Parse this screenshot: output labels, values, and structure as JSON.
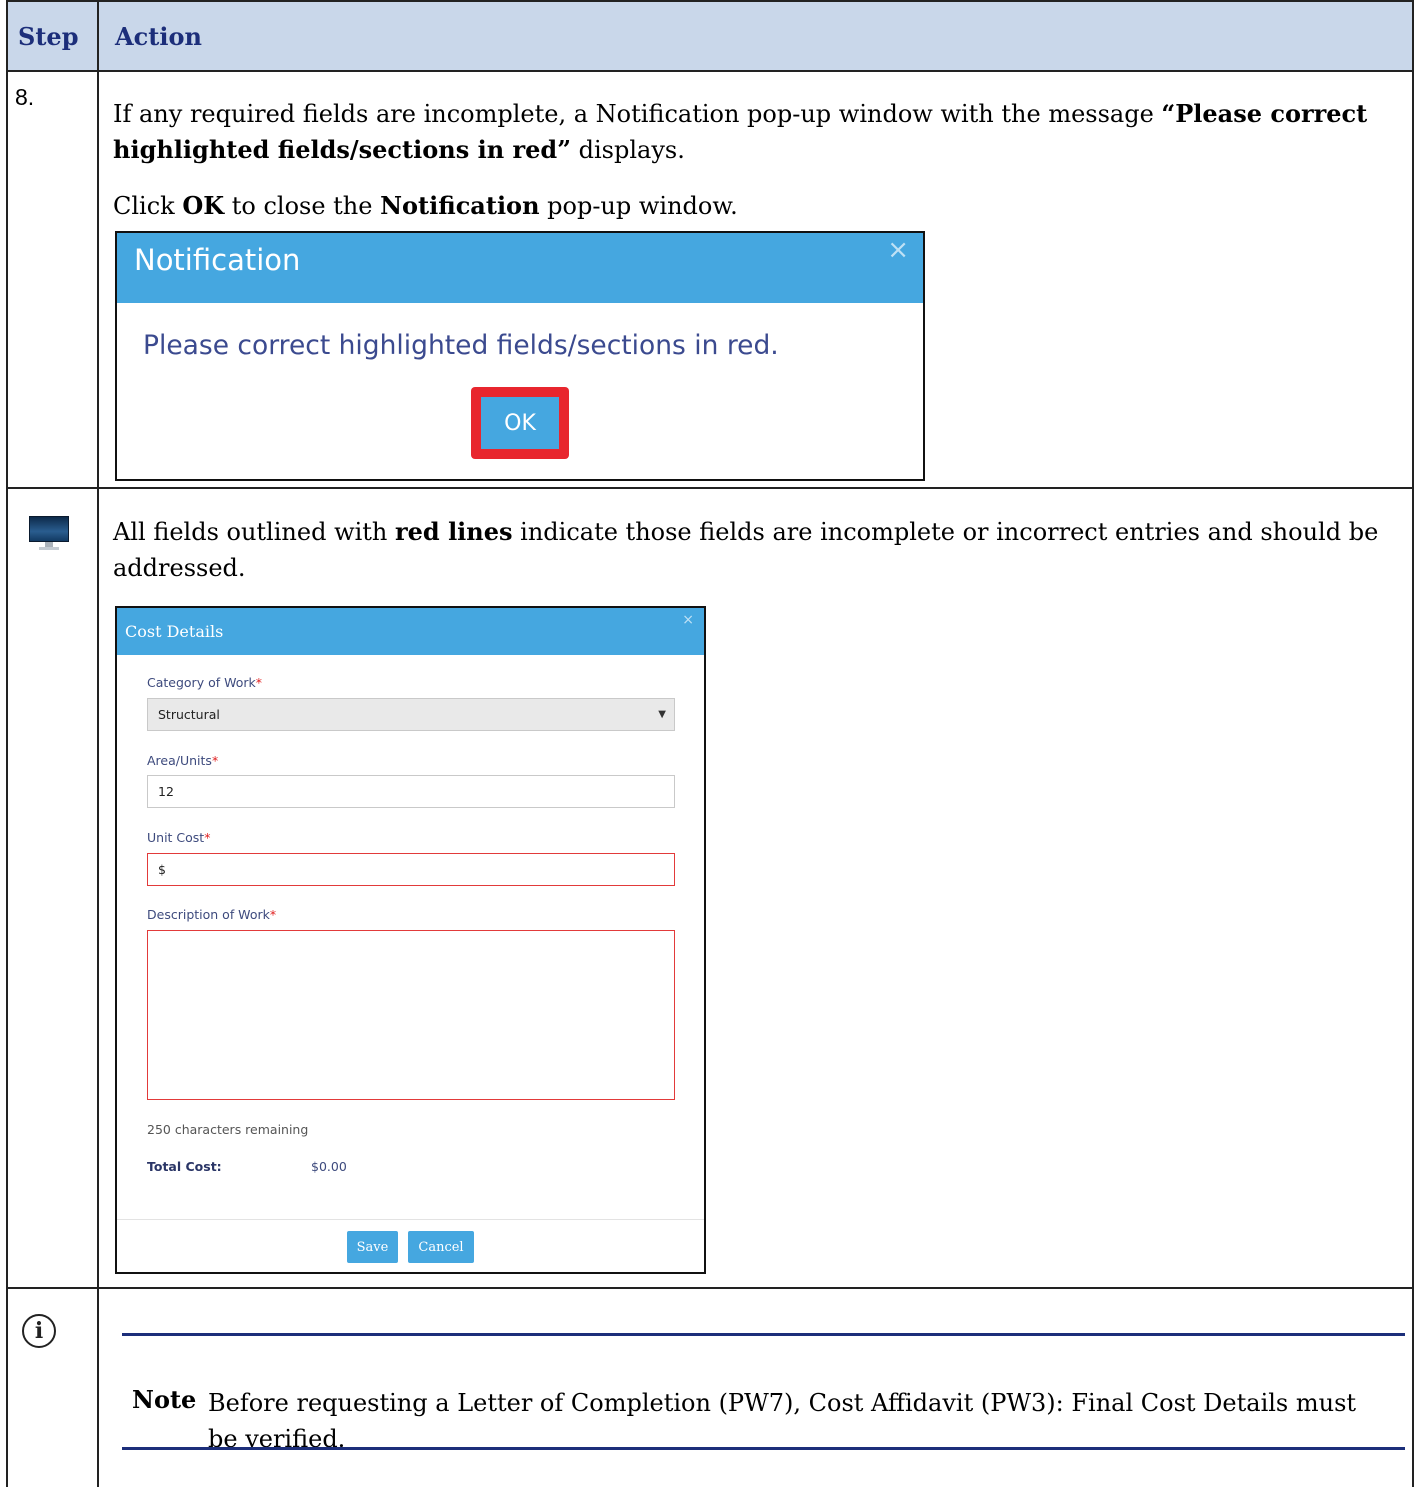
{
  "header": {
    "step": "Step",
    "action": "Action"
  },
  "row1": {
    "number": "8.",
    "para1_pre": "If any required fields are incomplete, a Notification pop-up window with the message ",
    "para1_bold": "“Please correct highlighted fields/sections in red”",
    "para1_post": " displays.",
    "para2_a": "Click ",
    "para2_b": "OK",
    "para2_c": " to close the ",
    "para2_d": "Notification",
    "para2_e": " pop-up window."
  },
  "notification": {
    "title": "Notification",
    "close": "×",
    "message": "Please correct highlighted fields/sections in red.",
    "ok_label": "OK"
  },
  "row2": {
    "icon": "monitor-icon",
    "text_pre": "All fields outlined with ",
    "text_bold": "red lines",
    "text_post": " indicate those fields are incomplete or incorrect entries and should be addressed."
  },
  "cost_details": {
    "title": "Cost Details",
    "close": "×",
    "category_label": "Category of Work",
    "category_value": "Structural",
    "area_label": "Area/Units",
    "area_value": "12",
    "unit_cost_label": "Unit Cost",
    "unit_cost_value": "$",
    "description_label": "Description of Work",
    "required_mark": "*",
    "remaining": "250 characters remaining",
    "total_label": "Total Cost:",
    "total_value": "$0.00",
    "save_label": "Save",
    "cancel_label": "Cancel",
    "invalid_border_color": "#e23a3a"
  },
  "note": {
    "icon": "info-icon",
    "label": "Note",
    "text": "Before requesting a Letter of Completion (PW7), Cost Affidavit (PW3): Final Cost Details must be verified."
  },
  "colors": {
    "header_bg": "#c9d7ea",
    "header_text": "#1c2e7a",
    "dialog_bar": "#45a7e0",
    "ok_highlight": "#e8262e"
  }
}
